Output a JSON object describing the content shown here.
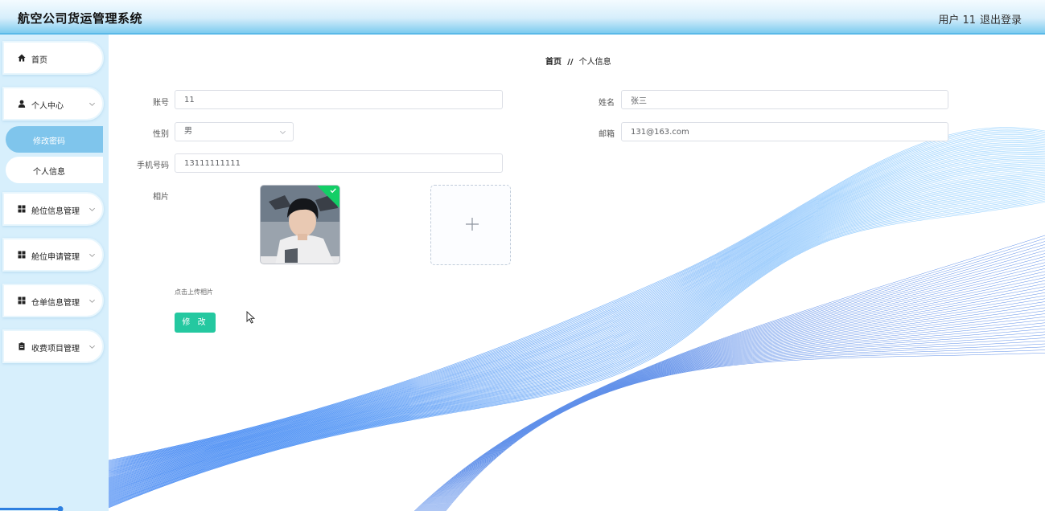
{
  "app": {
    "title": "航空公司货运管理系统"
  },
  "header": {
    "user_label": "用户 11",
    "logout_label": "退出登录"
  },
  "sidebar": {
    "home": {
      "label": "首页",
      "icon": "home-icon"
    },
    "personal_center": {
      "label": "个人中心",
      "icon": "user-icon",
      "children": [
        {
          "label": "修改密码",
          "active": true
        },
        {
          "label": "个人信息",
          "active": false
        }
      ]
    },
    "cabin_info": {
      "label": "舱位信息管理",
      "icon": "grid-icon"
    },
    "cabin_apply": {
      "label": "舱位申请管理",
      "icon": "grid-icon"
    },
    "waybill_info": {
      "label": "仓单信息管理",
      "icon": "grid-icon"
    },
    "charge_items": {
      "label": "收费项目管理",
      "icon": "clipboard-icon"
    }
  },
  "breadcrumb": {
    "home": "首页",
    "separator": "//",
    "current": "个人信息"
  },
  "form": {
    "account": {
      "label": "账号",
      "value": "11"
    },
    "name": {
      "label": "姓名",
      "value": "张三"
    },
    "gender": {
      "label": "性别",
      "value": "男"
    },
    "email": {
      "label": "邮箱",
      "value": "131@163.com"
    },
    "phone": {
      "label": "手机号码",
      "value": "13111111111"
    },
    "photo": {
      "label": "相片",
      "hint": "点击上传相片"
    },
    "submit_label": "修 改"
  },
  "colors": {
    "accent": "#24c8a0",
    "sidebar_bg": "#d7effc",
    "sub_active": "#7fc5ec",
    "header_border": "#5ab9e8"
  }
}
